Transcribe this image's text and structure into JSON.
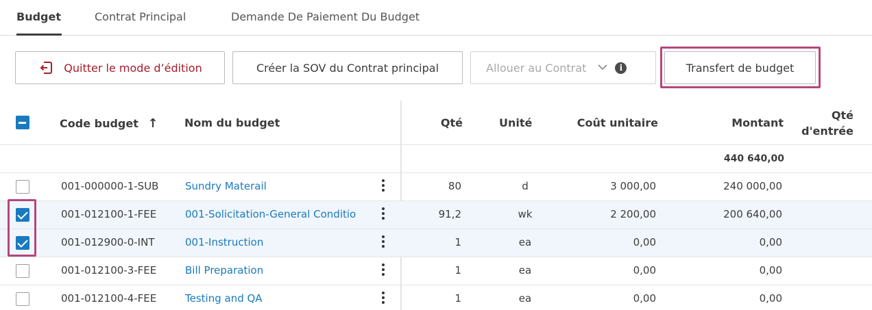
{
  "tabs": [
    {
      "label": "Budget",
      "active": true
    },
    {
      "label": "Contrat Principal",
      "active": false
    },
    {
      "label": "Demande De Paiement Du Budget",
      "active": false
    }
  ],
  "toolbar": {
    "exit_label": "Quitter le mode d’édition",
    "exit_icon": "exit-edit-icon",
    "create_sov_label": "Créer la SOV du Contrat principal",
    "allocate_label": "Allouer au Contrat",
    "allocate_info_glyph": "i",
    "transfer_label": "Transfert de budget"
  },
  "table": {
    "columns": {
      "code": "Code budget",
      "name": "Nom du budget",
      "qty": "Qté",
      "unit": "Unité",
      "unit_cost": "Coût unitaire",
      "amount": "Montant",
      "input_qty_line1": "Qté",
      "input_qty_line2": "d'entrée"
    },
    "sort_indicator": "↑",
    "total_amount": "440 640,00",
    "rows": [
      {
        "checked": false,
        "code": "001-000000-1-SUB",
        "name": "Sundry Materail",
        "qty": "80",
        "unit": "d",
        "unit_cost": "3 000,00",
        "amount": "240 000,00"
      },
      {
        "checked": true,
        "code": "001-012100-1-FEE",
        "name": "001-Solicitation-General Conditio",
        "qty": "91,2",
        "unit": "wk",
        "unit_cost": "2 200,00",
        "amount": "200 640,00"
      },
      {
        "checked": true,
        "code": "001-012900-0-INT",
        "name": "001-Instruction",
        "qty": "1",
        "unit": "ea",
        "unit_cost": "0,00",
        "amount": "0,00"
      },
      {
        "checked": false,
        "code": "001-012100-3-FEE",
        "name": "Bill Preparation",
        "qty": "1",
        "unit": "ea",
        "unit_cost": "0,00",
        "amount": "0,00"
      },
      {
        "checked": false,
        "code": "001-012100-4-FEE",
        "name": "Testing and QA",
        "qty": "1",
        "unit": "ea",
        "unit_cost": "0,00",
        "amount": "0,00"
      }
    ]
  },
  "colors": {
    "accent": "#1a7abf",
    "danger": "#a81d2a",
    "highlight": "#b5467e",
    "selected_row": "#f0f6fb"
  }
}
